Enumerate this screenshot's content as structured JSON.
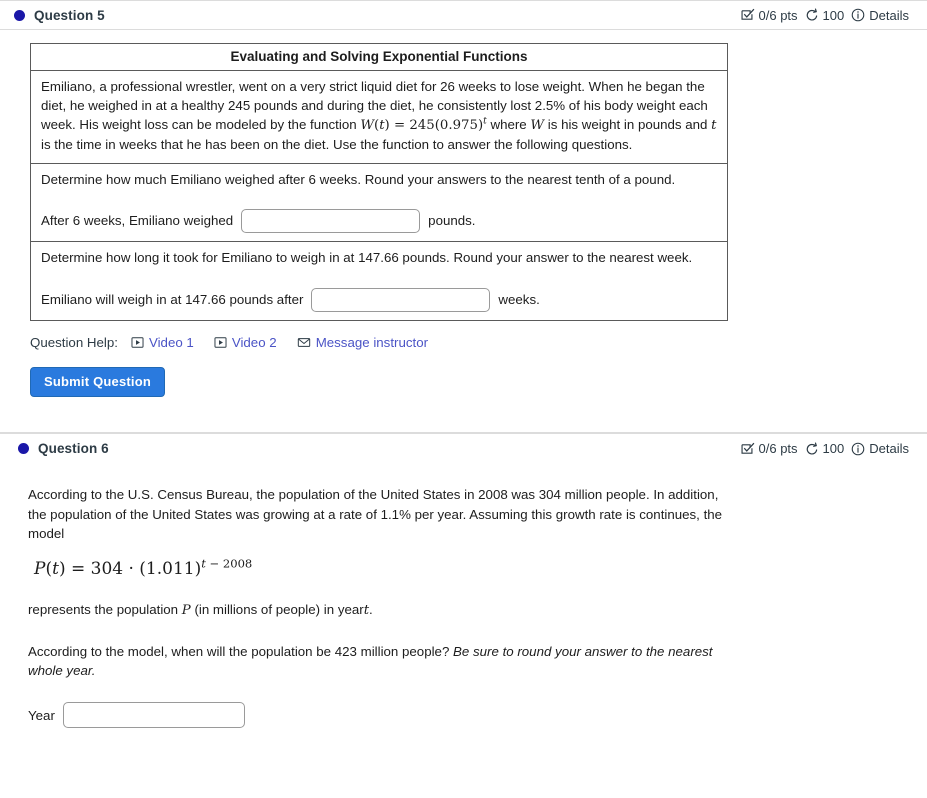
{
  "question5": {
    "dot_color": "#1a17a8",
    "title": "Question 5",
    "meta": {
      "points": "0/6 pts",
      "attempts": "100",
      "details": "Details",
      "checkbox_icon": "checkbox-check-icon",
      "history_icon": "rotate-left-icon",
      "info_icon": "info-circle-icon"
    },
    "problem": {
      "title": "Evaluating and Solving Exponential Functions",
      "intro_part1": "Emiliano, a professional wrestler, went on a very strict liquid diet for 26 weeks to lose weight. When he began the diet, he weighed in at a healthy 245 pounds and during the diet, he consistently lost 2.5% of his body weight each week. His weight loss can be modeled by the function",
      "intro_formula": "W(t) = 245(0.975)",
      "intro_formula_exp": "t",
      "intro_part2": "where",
      "intro_var_w": "W",
      "intro_part3": "is his weight in pounds and",
      "intro_var_t": "t",
      "intro_part4": "is the time in weeks that he has been on the diet. Use the function to answer the following questions.",
      "part_a": {
        "prompt": "Determine how much Emiliano weighed after 6 weeks. Round your answers to the nearest tenth of a pound.",
        "answer_prefix": "After 6 weeks, Emiliano weighed",
        "answer_suffix": "pounds.",
        "input_value": "",
        "input_placeholder": ""
      },
      "part_b": {
        "prompt": "Determine how long it took for Emiliano to weigh in at 147.66 pounds. Round your answer to the nearest week.",
        "answer_prefix": "Emiliano will weigh in at 147.66 pounds after",
        "answer_suffix": "weeks.",
        "input_value": "",
        "input_placeholder": ""
      }
    },
    "help": {
      "label": "Question Help:",
      "video1": "Video 1",
      "video2": "Video 2",
      "message": "Message instructor",
      "video_icon": "play-button-icon",
      "message_icon": "envelope-icon",
      "link_color": "#4b54c6"
    },
    "submit_label": "Submit Question",
    "submit_color": "#2a7ade"
  },
  "question6": {
    "dot_color": "#1a17a8",
    "title": "Question 6",
    "meta": {
      "points": "0/6 pts",
      "attempts": "100",
      "details": "Details",
      "checkbox_icon": "checkbox-check-icon",
      "history_icon": "rotate-left-icon",
      "info_icon": "info-circle-icon"
    },
    "body": {
      "para1": "According to the U.S. Census Bureau, the population of the United States in 2008 was 304 million people. In addition, the population of the United States was growing at a rate of 1.1% per year. Assuming this growth rate is continues, the model",
      "formula_base": "P(t) = 304 · (1.011)",
      "formula_exp": "t − 2008",
      "para2_part1": "represents the population",
      "para2_var_p": "P",
      "para2_part2": "(in millions of people) in year",
      "para2_var_t": "t",
      "para2_part3": ".",
      "para3_plain": "According to the model, when will the population be 423 million people?",
      "para3_italic": "Be sure to round your answer to the nearest whole year.",
      "year_label": "Year",
      "year_value": "",
      "year_placeholder": ""
    }
  }
}
